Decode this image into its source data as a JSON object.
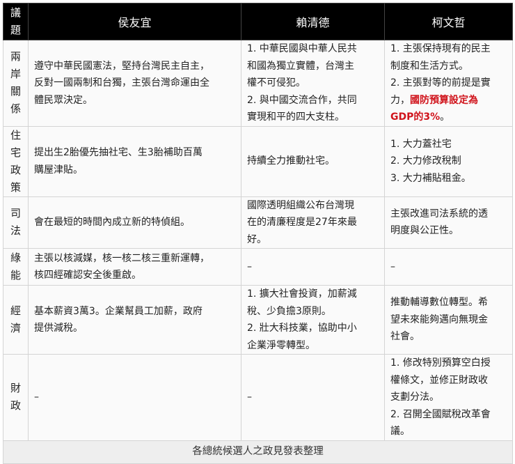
{
  "header": {
    "issue": [
      "議",
      "題"
    ],
    "candidates": [
      "侯友宜",
      "賴清德",
      "柯文哲"
    ]
  },
  "rows": [
    {
      "issue": [
        "兩",
        "岸",
        "關",
        "係"
      ],
      "cells": [
        [
          "遵守中華民國憲法，堅持台灣民主自主，",
          "反對一國兩制和台獨，主張台灣命運由全",
          "體民眾決定。"
        ],
        [
          "1. 中華民國與中華人民共",
          "和國為獨立實體，台灣主",
          "權不可侵犯。",
          "2. 與中國交流合作，共同",
          "實現和平的四大支柱。"
        ],
        [
          "1. 主張保持現有的民主",
          "制度和生活方式。",
          "2. 主張對等的前提是實",
          [
            {
              "t": "力，"
            },
            {
              "t": "國防預算設定為",
              "red": true
            }
          ],
          [
            {
              "t": "GDP的3%",
              "red": true
            },
            {
              "t": "。"
            }
          ]
        ]
      ]
    },
    {
      "issue": [
        "住",
        "宅",
        "政",
        "策"
      ],
      "cells": [
        [
          "提出生2胎優先抽社宅、生3胎補助百萬",
          "購屋津貼。"
        ],
        [
          "持續全力推動社宅。"
        ],
        [
          "1. 大力蓋社宅",
          "2. 大力修改稅制",
          "3. 大力補貼租金。"
        ]
      ]
    },
    {
      "issue": [
        "司",
        "法"
      ],
      "cells": [
        [
          "會在最短的時間內成立新的特偵組。"
        ],
        [
          "國際透明組織公布台灣現",
          "在的清廉程度是27年來最",
          "好。"
        ],
        [
          "主張改進司法系統的透",
          "明度與公正性。"
        ]
      ]
    },
    {
      "issue": [
        "綠",
        "能"
      ],
      "cells": [
        [
          "主張以核減媒，核一核二核三重新運轉，",
          "核四經確認安全後重啟。"
        ],
        [
          "–"
        ],
        [
          "–"
        ]
      ]
    },
    {
      "issue": [
        "經",
        "濟"
      ],
      "cells": [
        [
          "基本薪資3萬3。企業幫員工加薪，政府",
          "提供減稅。"
        ],
        [
          "1. 擴大社會投資，加薪減",
          "稅、少負擔3原則。",
          "2. 壯大科技業，協助中小",
          "企業淨零轉型。"
        ],
        [
          "推動輔導數位轉型。希",
          "望未來能夠邁向無現金",
          "社會。"
        ]
      ]
    },
    {
      "issue": [
        "財",
        "政"
      ],
      "cells": [
        [
          "–"
        ],
        [
          "–"
        ],
        [
          "1. 修改特別預算空白授",
          "權條文，並修正財政收",
          "支劃分法。",
          "2. 召開全國賦稅改革會",
          "議。"
        ]
      ]
    }
  ],
  "footer": "各總統候選人之政見發表整理",
  "colors": {
    "header_bg": "#000000",
    "highlight": "#d0141c",
    "footer_bg": "#eeeeee"
  }
}
